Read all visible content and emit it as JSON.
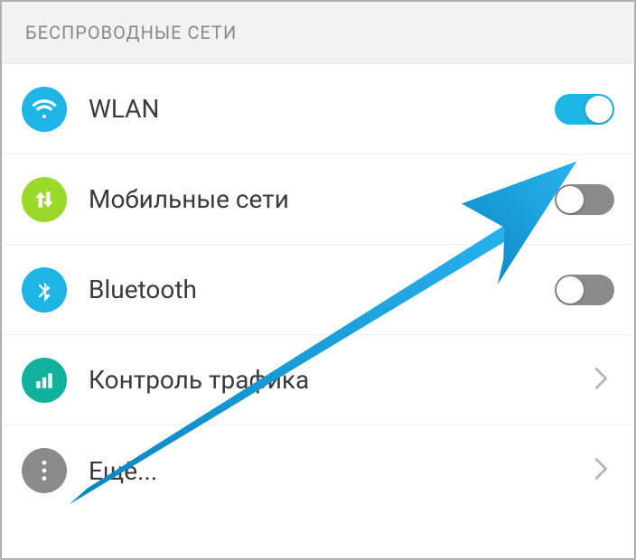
{
  "section_title": "БЕСПРОВОДНЫЕ СЕТИ",
  "rows": {
    "wlan": {
      "label": "WLAN",
      "toggle_on": true
    },
    "mobile": {
      "label": "Мобильные сети",
      "toggle_on": false
    },
    "bluetooth": {
      "label": "Bluetooth",
      "toggle_on": false
    },
    "traffic": {
      "label": "Контроль трафика"
    },
    "more": {
      "label": "Ещё..."
    }
  },
  "colors": {
    "wlan_icon": "#1db4e6",
    "mobile_icon": "#9ad82a",
    "bluetooth_icon": "#1db4e6",
    "traffic_icon": "#11b19c",
    "more_icon": "#8a8a8a",
    "arrow": "#0a86c2"
  }
}
